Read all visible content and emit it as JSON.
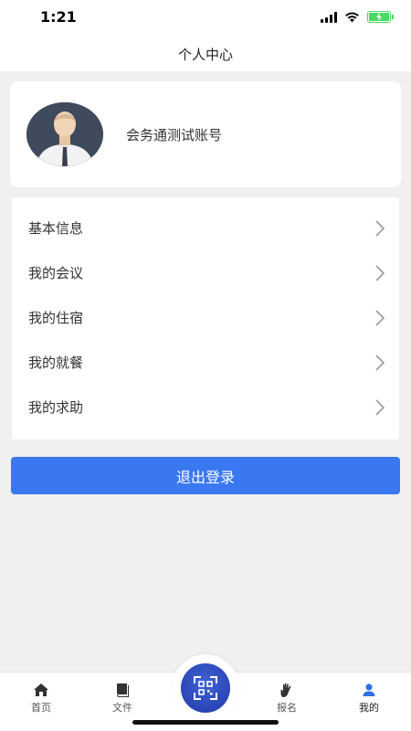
{
  "status_bar": {
    "time": "1:21"
  },
  "header": {
    "title": "个人中心"
  },
  "profile": {
    "name": "会务通测试账号"
  },
  "menu": {
    "items": [
      {
        "label": "基本信息"
      },
      {
        "label": "我的会议"
      },
      {
        "label": "我的住宿"
      },
      {
        "label": "我的就餐"
      },
      {
        "label": "我的求助"
      }
    ]
  },
  "logout": {
    "label": "退出登录"
  },
  "tabbar": {
    "items": [
      {
        "label": "首页",
        "icon": "home-icon"
      },
      {
        "label": "文件",
        "icon": "book-icon"
      },
      {
        "label": "报名",
        "icon": "hand-icon"
      },
      {
        "label": "我的",
        "icon": "user-icon",
        "active": true
      }
    ],
    "center_icon": "scan-icon"
  },
  "colors": {
    "accent": "#3a78f2",
    "scan_button": "#2a45b6",
    "battery": "#4cd964",
    "background": "#f0f0f0"
  }
}
